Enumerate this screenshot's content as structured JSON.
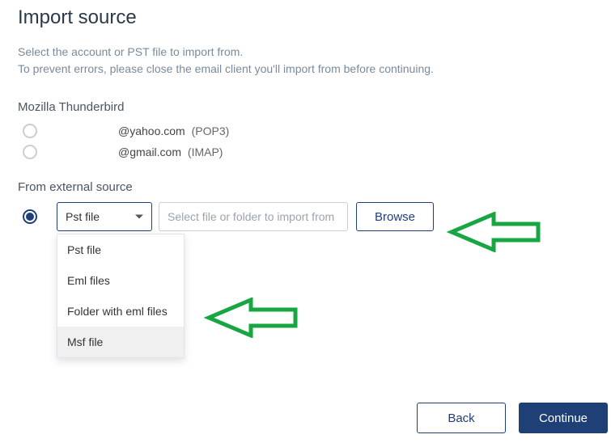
{
  "title": "Import source",
  "subtitle_line1": "Select the account or PST file to import from.",
  "subtitle_line2": "To prevent errors, please close the email client you'll import from before continuing.",
  "accounts_section_label": "Mozilla Thunderbird",
  "accounts": [
    {
      "address": "@yahoo.com",
      "protocol": "(POP3)"
    },
    {
      "address": "@gmail.com",
      "protocol": "(IMAP)"
    }
  ],
  "external_section_label": "From external source",
  "dropdown": {
    "selected": "Pst file",
    "options": [
      "Pst file",
      "Eml files",
      "Folder with eml files",
      "Msf file"
    ],
    "hovered_index": 3
  },
  "file_input": {
    "value": "",
    "placeholder": "Select file or folder to import from"
  },
  "browse_label": "Browse",
  "back_label": "Back",
  "continue_label": "Continue",
  "accent_color": "#1f3f77",
  "arrow_color": "#18a642"
}
